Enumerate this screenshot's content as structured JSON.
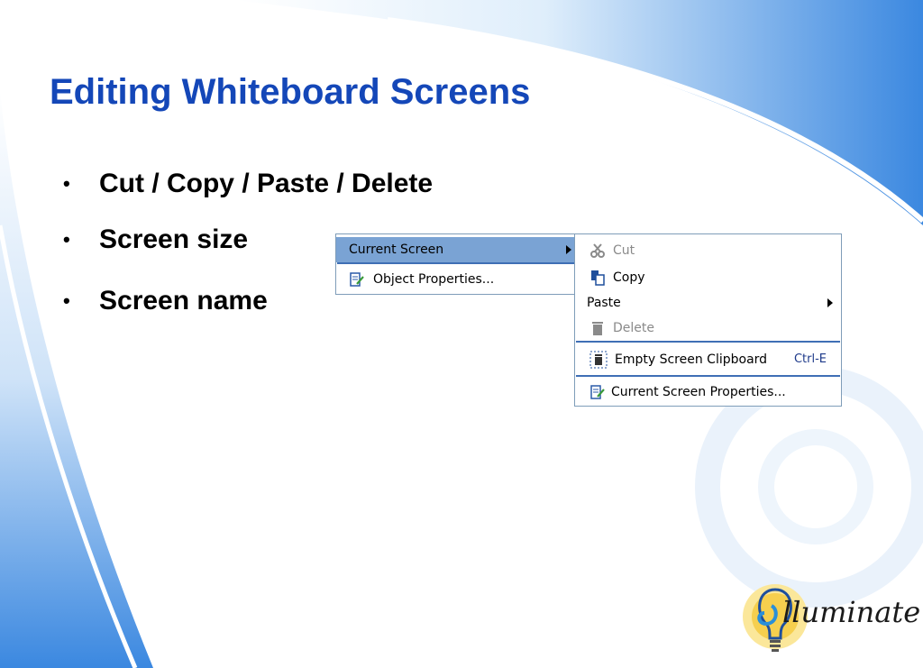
{
  "slide": {
    "title": "Editing Whiteboard Screens",
    "bullets": [
      "Cut / Copy / Paste / Delete",
      "Screen size",
      "Screen name"
    ],
    "bullet_glyph": "•"
  },
  "context_menu": {
    "items": [
      {
        "label": "Current Screen",
        "icon": "",
        "selected": true,
        "has_submenu": true
      },
      {
        "label": "Object Properties...",
        "icon": "properties-icon"
      }
    ]
  },
  "submenu": {
    "items": [
      {
        "label": "Cut",
        "icon": "scissors-icon",
        "enabled": false
      },
      {
        "label": "Copy",
        "icon": "copy-icon",
        "enabled": true
      },
      {
        "label": "Paste",
        "icon": "",
        "enabled": true,
        "has_submenu": true
      },
      {
        "label": "Delete",
        "icon": "trash-icon",
        "enabled": false
      },
      {
        "label": "Empty Screen Clipboard",
        "icon": "clipboard-trash-icon",
        "shortcut": "Ctrl-E",
        "enabled": true
      },
      {
        "label": "Current Screen Properties...",
        "icon": "properties-icon",
        "enabled": true
      }
    ]
  },
  "logo": {
    "text": "lluminate"
  },
  "colors": {
    "title": "#1447b8",
    "menu_highlight": "#7aa3d4",
    "menu_separator": "#3f6fb5",
    "background_swoosh": "#2f7ddb"
  }
}
